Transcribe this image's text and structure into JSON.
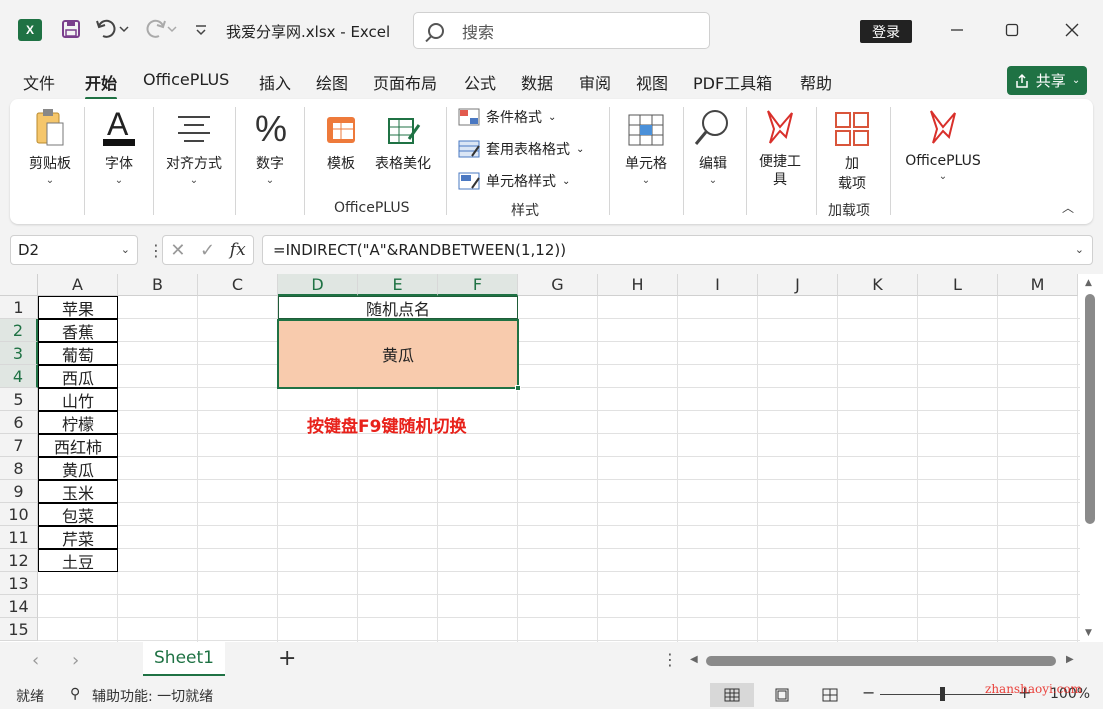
{
  "titlebar": {
    "app_logo": "excel-logo",
    "title": "我爱分享网.xlsx  -  Excel",
    "search_placeholder": "搜索",
    "login_label": "登录",
    "logo_letter": "X"
  },
  "menu": {
    "items": [
      "文件",
      "开始",
      "OfficePLUS",
      "插入",
      "绘图",
      "页面布局",
      "公式",
      "数据",
      "审阅",
      "视图",
      "PDF工具箱",
      "帮助"
    ],
    "active": "开始",
    "share_label": "共享"
  },
  "ribbon": {
    "clipboard": "剪贴板",
    "font": "字体",
    "align": "对齐方式",
    "number": "数字",
    "template": "模板",
    "beautify": "表格美化",
    "officeplus_group": "OfficePLUS",
    "cond_format": "条件格式",
    "table_format": "套用表格格式",
    "cell_style": "单元格样式",
    "style_group": "样式",
    "cells": "单元格",
    "edit": "编辑",
    "quick_tools": "便捷工具",
    "addin_line1": "加",
    "addin_line2": "载项",
    "addin_group": "加载项",
    "officeplus_btn": "OfficePLUS"
  },
  "formula_bar": {
    "name_box": "D2",
    "formula": "=INDIRECT(\"A\"&RANDBETWEEN(1,12))",
    "fx_label": "fx"
  },
  "sheet": {
    "columns": [
      "A",
      "B",
      "C",
      "D",
      "E",
      "F",
      "G",
      "H",
      "I",
      "J",
      "K",
      "L",
      "M"
    ],
    "rows": [
      "1",
      "2",
      "3",
      "4",
      "5",
      "6",
      "7",
      "8",
      "9",
      "10",
      "11",
      "12",
      "13",
      "14",
      "15"
    ],
    "column_a": [
      "苹果",
      "香蕉",
      "葡萄",
      "西瓜",
      "山竹",
      "柠檬",
      "西红柿",
      "黄瓜",
      "玉米",
      "包菜",
      "芹菜",
      "土豆"
    ],
    "title_cell": "随机点名",
    "result_cell": "黄瓜",
    "note": "按键盘F9键随机切换",
    "result_fill": "#f8cbad",
    "note_color": "#e8221b",
    "accent": "#1f7244"
  },
  "sheet_tabs": {
    "active": "Sheet1"
  },
  "status": {
    "ready": "就绪",
    "accessibility": "辅助功能: 一切就绪",
    "zoom": "100%",
    "watermark": "zhanshaoyi.com"
  }
}
